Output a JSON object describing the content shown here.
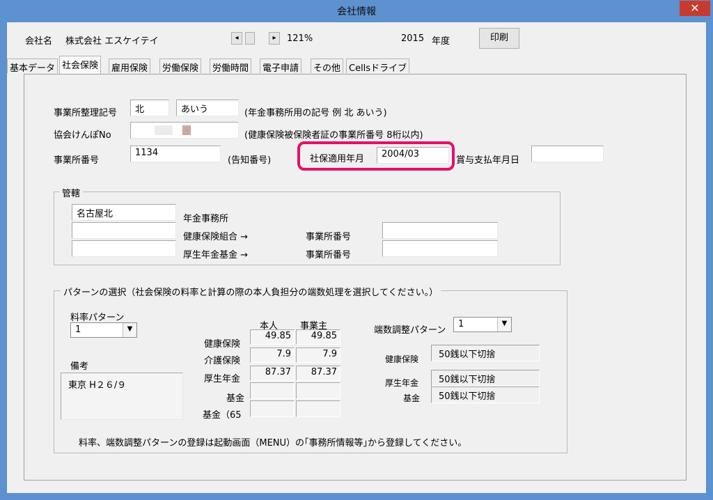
{
  "window": {
    "title": "会社情報",
    "close_glyph": "✕"
  },
  "header": {
    "company_label": "会社名",
    "company_name": "株式会社  エスケイテイ",
    "nav_prev": "◂",
    "nav_next": "▸",
    "zoom": "121%",
    "year": "2015",
    "year_label": "年度",
    "print_label": "印刷"
  },
  "tabs": [
    {
      "label": "基本データ",
      "active": false
    },
    {
      "label": "社会保険",
      "active": true
    },
    {
      "label": "雇用保険",
      "active": false
    },
    {
      "label": "労働保険",
      "active": false
    },
    {
      "label": "労働時間",
      "active": false
    },
    {
      "label": "電子申請",
      "active": false
    },
    {
      "label": "その他",
      "active": false
    },
    {
      "label": "Cellsドライブ",
      "active": false
    }
  ],
  "fields": {
    "office_code_label": "事業所整理記号",
    "office_code_1": "北",
    "office_code_2": "あいう",
    "office_code_hint": "(年金事務所用の記号  例  北  あいう)",
    "kyokai_label": "協会けんぽNo",
    "kyokai_hint": "(健康保険被保険者証の事業所番号  8桁以内)",
    "office_number_label": "事業所番号",
    "office_number_value": "1134",
    "office_number_hint": "(告知番号)",
    "apply_ym_label": "社保適用年月",
    "apply_ym_value": "2004/03",
    "bonus_date_label": "賞与支払年月日",
    "bonus_date_value": ""
  },
  "jurisdiction": {
    "legend": "管轄",
    "pension_office_value": "名古屋北",
    "pension_office_label": "年金事務所",
    "health_union_label": "健康保険組合  →",
    "pension_fund_label": "厚生年金基金  →",
    "office_number_label_1": "事業所番号",
    "office_number_label_2": "事業所番号"
  },
  "pattern": {
    "legend": "パターンの選択（社会保険の料率と計算の際の本人負担分の端数処理を選択してください。）",
    "rate_pattern_label": "料率パターン",
    "rate_pattern_value": "1",
    "remarks_label": "備考",
    "remarks_value": "東京  H２６/９",
    "col_self": "本人",
    "col_employer": "事業主",
    "rows": [
      {
        "label": "健康保険",
        "self": "49.85",
        "employer": "49.85"
      },
      {
        "label": "介護保険",
        "self": "7.9",
        "employer": "7.9"
      },
      {
        "label": "厚生年金",
        "self": "87.37",
        "employer": "87.37"
      },
      {
        "label": "基金",
        "self": "",
        "employer": ""
      },
      {
        "label": "基金（65",
        "self": "",
        "employer": ""
      }
    ],
    "rounding_pattern_label": "端数調整パターン",
    "rounding_pattern_value": "1",
    "rounding_rows": [
      {
        "label": "健康保険",
        "value": "50銭以下切捨"
      },
      {
        "label": "厚生年金",
        "value": "50銭以下切捨"
      },
      {
        "label": "基金",
        "value": "50銭以下切捨"
      }
    ],
    "footnote": "料率、端数調整パターンの登録は起動画面（MENU）の｢事務所情報等｣から登録してください。"
  },
  "colors": {
    "titlebar": "#5b92cf",
    "close": "#c73a2f",
    "highlight": "#e4106a"
  },
  "icons": {
    "dropdown": "▼"
  }
}
